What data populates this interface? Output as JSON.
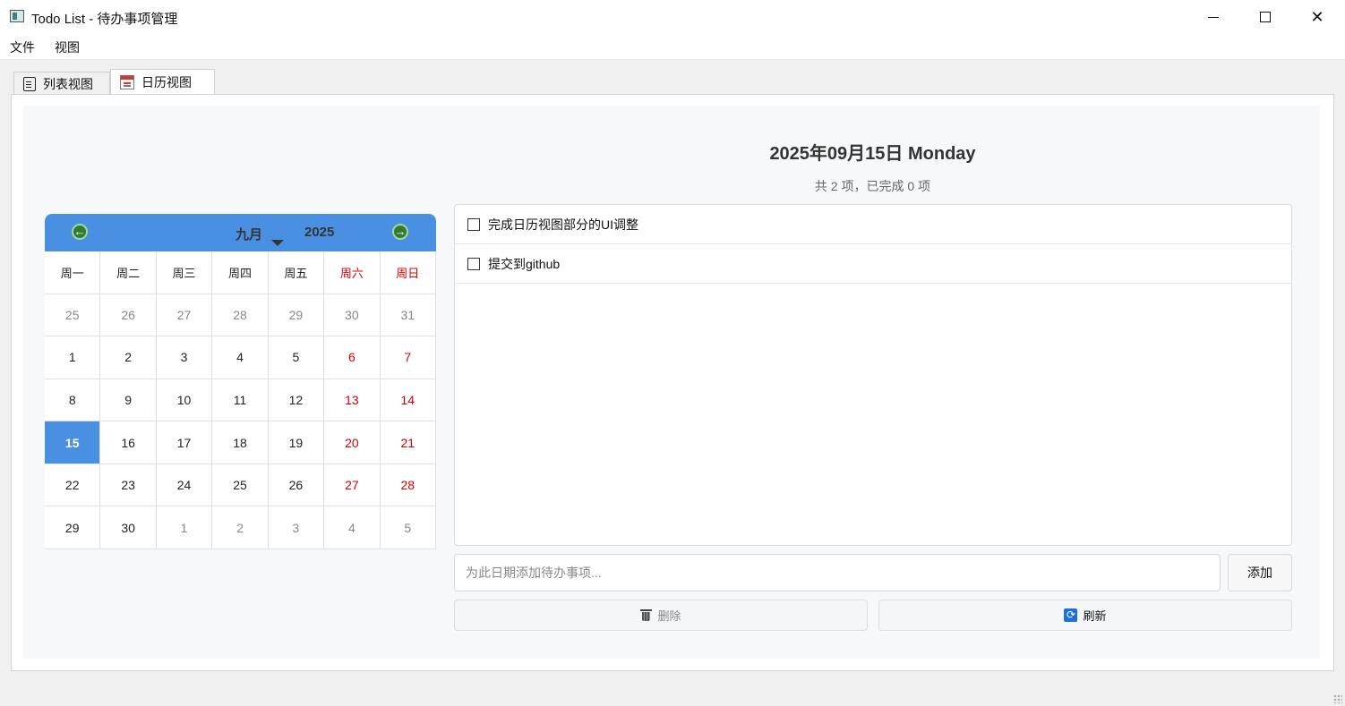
{
  "window": {
    "title": "Todo List - 待办事项管理",
    "minimize": "",
    "maximize": "",
    "close": "✕"
  },
  "menu": [
    "文件",
    "视图"
  ],
  "tabs": [
    {
      "label": "列表视图",
      "icon": "document-icon",
      "active": false
    },
    {
      "label": "日历视图",
      "icon": "calendar-icon",
      "active": true
    }
  ],
  "calendar": {
    "prev": "←",
    "next": "→",
    "month": "九月",
    "year": "2025",
    "weekdays": [
      "周一",
      "周二",
      "周三",
      "周四",
      "周五",
      "周六",
      "周日"
    ],
    "weeks": [
      [
        "25",
        "26",
        "27",
        "28",
        "29",
        "30",
        "31"
      ],
      [
        "1",
        "2",
        "3",
        "4",
        "5",
        "6",
        "7"
      ],
      [
        "8",
        "9",
        "10",
        "11",
        "12",
        "13",
        "14"
      ],
      [
        "15",
        "16",
        "17",
        "18",
        "19",
        "20",
        "21"
      ],
      [
        "22",
        "23",
        "24",
        "25",
        "26",
        "27",
        "28"
      ],
      [
        "29",
        "30",
        "1",
        "2",
        "3",
        "4",
        "5"
      ]
    ],
    "selected": "15",
    "header_color": "#4a90e2",
    "weekend_color": "#dd0000"
  },
  "detail": {
    "date_title": "2025年09月15日 Monday",
    "summary": "共 2 项，已完成 0 项",
    "todos": [
      {
        "text": "完成日历视图部分的UI调整",
        "done": false
      },
      {
        "text": "提交到github",
        "done": false
      }
    ],
    "input_placeholder": "为此日期添加待办事项...",
    "add_label": "添加",
    "delete_label": "删除",
    "refresh_label": "刷新",
    "refresh_icon_glyph": "⟳"
  }
}
